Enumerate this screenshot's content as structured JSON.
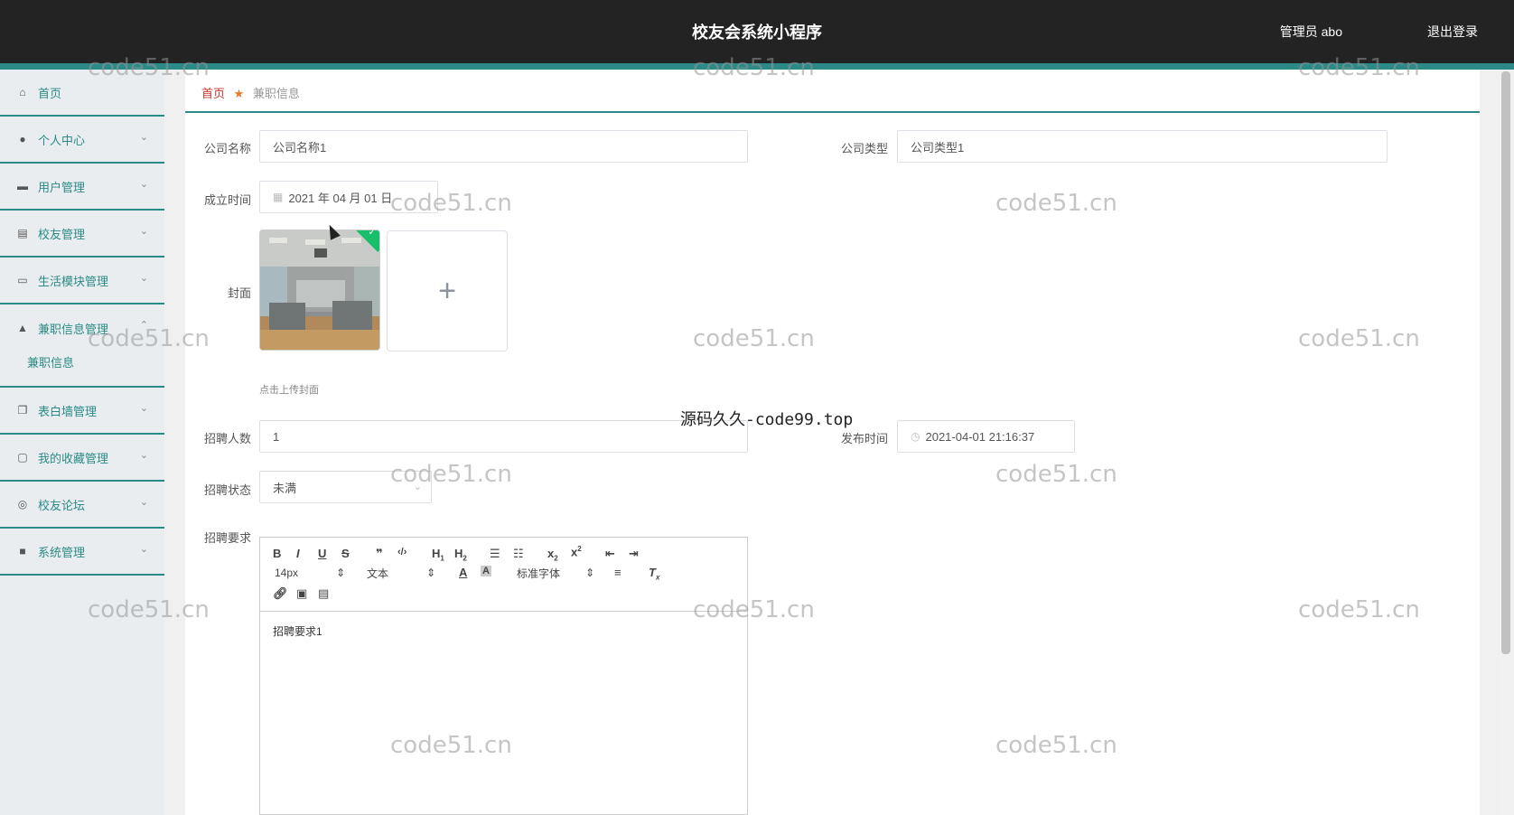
{
  "header": {
    "title": "校友会系统小程序",
    "admin": "管理员 abo",
    "logout": "退出登录"
  },
  "sidebar": {
    "items": [
      {
        "label": "首页",
        "icon": "home-icon",
        "chevron": ""
      },
      {
        "label": "个人中心",
        "icon": "user-icon",
        "chevron": "⌄"
      },
      {
        "label": "用户管理",
        "icon": "briefcase-icon",
        "chevron": "⌄"
      },
      {
        "label": "校友管理",
        "icon": "clipboard-icon",
        "chevron": "⌄"
      },
      {
        "label": "生活模块管理",
        "icon": "card-icon",
        "chevron": "⌄"
      },
      {
        "label": "兼职信息管理",
        "icon": "person-icon",
        "chevron": "⌃"
      },
      {
        "label": "表白墙管理",
        "icon": "copy-icon",
        "chevron": "⌄"
      },
      {
        "label": "我的收藏管理",
        "icon": "message-icon",
        "chevron": "⌄"
      },
      {
        "label": "校友论坛",
        "icon": "globe-icon",
        "chevron": "⌄"
      },
      {
        "label": "系统管理",
        "icon": "settings-icon",
        "chevron": "⌄"
      }
    ],
    "sub_item": "兼职信息"
  },
  "breadcrumb": {
    "home": "首页",
    "current": "兼职信息"
  },
  "form": {
    "company_name_label": "公司名称",
    "company_name_value": "公司名称1",
    "company_type_label": "公司类型",
    "company_type_value": "公司类型1",
    "founded_label": "成立时间",
    "founded_value": "2021 年 04 月 01 日",
    "cover_label": "封面",
    "upload_tip": "点击上传封面",
    "headcount_label": "招聘人数",
    "headcount_value": "1",
    "publish_label": "发布时间",
    "publish_value": "2021-04-01 21:16:37",
    "status_label": "招聘状态",
    "status_value": "未满",
    "requirements_label": "招聘要求",
    "requirements_value": "招聘要求1"
  },
  "editor": {
    "font_size": "14px",
    "text_style": "文本",
    "font_family": "标准字体"
  },
  "watermark_text": "code51.cn",
  "source_mark": "源码久久-code99.top",
  "colors": {
    "accent": "#2b8a86",
    "topbar": "#232323",
    "sidebar": "#e9edf0"
  }
}
